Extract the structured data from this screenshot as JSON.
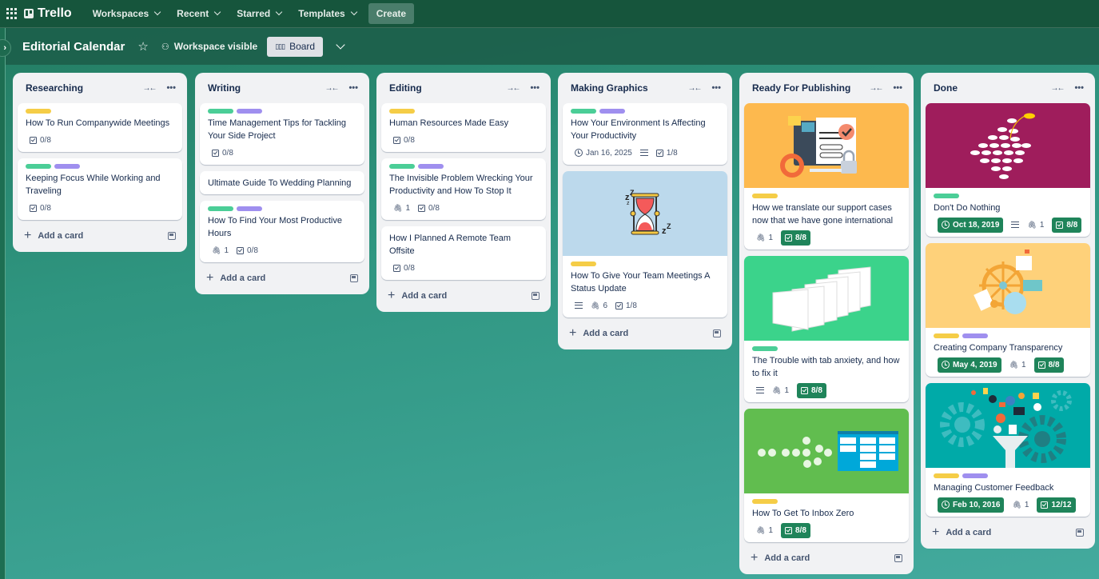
{
  "topnav": {
    "app_name": "Trello",
    "items": [
      {
        "label": "Workspaces"
      },
      {
        "label": "Recent"
      },
      {
        "label": "Starred"
      },
      {
        "label": "Templates"
      }
    ],
    "create_label": "Create"
  },
  "board": {
    "title": "Editorial Calendar",
    "visibility": "Workspace visible",
    "view": "Board"
  },
  "colors": {
    "label_yellow": "#f5cd47",
    "label_green": "#4bce97",
    "label_purple": "#9f8fef",
    "complete_badge": "#1f845a",
    "nav_bg": "#16553c"
  },
  "add_card_label": "Add a card",
  "lists": [
    {
      "title": "Researching",
      "cards": [
        {
          "labels": [
            "yellow"
          ],
          "title": "How To Run Companywide Meetings",
          "checklist": "0/8"
        },
        {
          "labels": [
            "green",
            "purple"
          ],
          "title": "Keeping Focus While Working and Traveling",
          "checklist": "0/8"
        }
      ]
    },
    {
      "title": "Writing",
      "cards": [
        {
          "labels": [
            "green",
            "purple"
          ],
          "title": "Time Management Tips for Tackling Your Side Project",
          "checklist": "0/8"
        },
        {
          "labels": [],
          "title": "Ultimate Guide To Wedding Planning"
        },
        {
          "labels": [
            "green",
            "purple"
          ],
          "title": "How To Find Your Most Productive Hours",
          "attachments": "1",
          "checklist": "0/8"
        }
      ]
    },
    {
      "title": "Editing",
      "cards": [
        {
          "labels": [
            "yellow"
          ],
          "title": "Human Resources Made Easy",
          "checklist": "0/8"
        },
        {
          "labels": [
            "green",
            "purple"
          ],
          "title": "The Invisible Problem Wrecking Your Productivity and How To Stop It",
          "attachments": "1",
          "checklist": "0/8"
        },
        {
          "labels": [],
          "title": "How I Planned A Remote Team Offsite",
          "checklist": "0/8"
        }
      ]
    },
    {
      "title": "Making Graphics",
      "cards": [
        {
          "labels": [
            "green",
            "purple"
          ],
          "title": "How Your Environment Is Affecting Your Productivity",
          "due": "Jan 16, 2025",
          "description": true,
          "checklist": "1/8"
        },
        {
          "cover": "hourglass",
          "labels": [
            "yellow"
          ],
          "title": "How To Give Your Team Meetings A Status Update",
          "description": true,
          "attachments": "6",
          "checklist": "1/8"
        }
      ]
    },
    {
      "title": "Ready For Publishing",
      "cards": [
        {
          "cover": "support-monitor",
          "labels": [
            "yellow"
          ],
          "title": "How we translate our support cases now that we have gone international",
          "attachments": "1",
          "checklist": "8/8",
          "checklist_complete": true
        },
        {
          "cover": "browser-tabs",
          "labels": [
            "green"
          ],
          "title": "The Trouble with tab anxiety, and how to fix it",
          "description": true,
          "attachments": "1",
          "checklist": "8/8",
          "checklist_complete": true
        },
        {
          "cover": "inbox-board",
          "labels": [
            "yellow"
          ],
          "title": "How To Get To Inbox Zero",
          "attachments": "1",
          "checklist": "8/8",
          "checklist_complete": true
        }
      ]
    },
    {
      "title": "Done",
      "cards": [
        {
          "cover": "fish-school",
          "labels": [
            "green"
          ],
          "title": "Don't Do Nothing",
          "due": "Oct 18, 2019",
          "due_complete": true,
          "description": true,
          "attachments": "1",
          "checklist": "8/8",
          "checklist_complete": true
        },
        {
          "cover": "ship-wheel",
          "labels": [
            "yellow",
            "purple"
          ],
          "title": "Creating Company Transparency",
          "due": "May 4, 2019",
          "due_complete": true,
          "attachments": "1",
          "checklist": "8/8",
          "checklist_complete": true
        },
        {
          "cover": "feedback-funnel",
          "labels": [
            "yellow",
            "purple"
          ],
          "title": "Managing Customer Feedback",
          "due": "Feb 10, 2016",
          "due_complete": true,
          "attachments": "1",
          "checklist": "12/12",
          "checklist_complete": true
        }
      ]
    }
  ]
}
